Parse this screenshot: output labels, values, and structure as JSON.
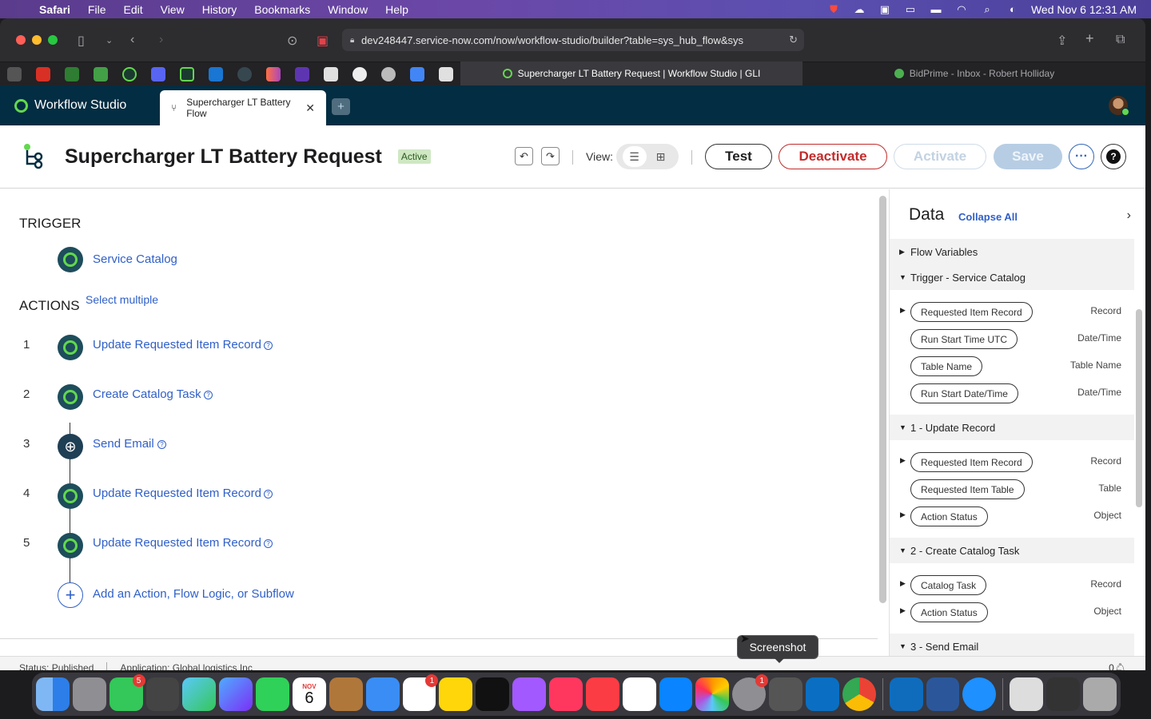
{
  "menubar": {
    "app_name": "Safari",
    "items": [
      "File",
      "Edit",
      "View",
      "History",
      "Bookmarks",
      "Window",
      "Help"
    ],
    "clock": "Wed Nov 6  12:31 AM"
  },
  "browser": {
    "url": "dev248447.service-now.com/now/workflow-studio/builder?table=sys_hub_flow&sys",
    "tabs": [
      {
        "label": "Supercharger LT Battery Request | Workflow Studio | GLI"
      },
      {
        "label": "BidPrime - Inbox - Robert Holliday"
      }
    ]
  },
  "app": {
    "brand": "Workflow Studio",
    "tab_label": "Supercharger LT Battery Flow",
    "add_tab": "+"
  },
  "header": {
    "title": "Supercharger LT Battery Request",
    "status_badge": "Active",
    "view_label": "View:",
    "test": "Test",
    "deactivate": "Deactivate",
    "activate": "Activate",
    "save": "Save",
    "more": "···",
    "help": "?"
  },
  "flow": {
    "trigger_heading": "TRIGGER",
    "trigger_name": "Service Catalog",
    "actions_heading": "ACTIONS",
    "select_multiple": "Select multiple",
    "steps": [
      {
        "num": "1",
        "label": "Update Requested Item Record"
      },
      {
        "num": "2",
        "label": "Create Catalog Task"
      },
      {
        "num": "3",
        "label": "Send Email"
      },
      {
        "num": "4",
        "label": "Update Requested Item Record"
      },
      {
        "num": "5",
        "label": "Update Requested Item Record"
      }
    ],
    "add_action": "Add an Action, Flow Logic, or Subflow"
  },
  "data_panel": {
    "title": "Data",
    "collapse_all": "Collapse All",
    "sections": {
      "flow_variables": "Flow Variables",
      "trigger": "Trigger - Service Catalog",
      "update_record": "1 - Update Record",
      "create_task": "2 - Create Catalog Task",
      "send_email": "3 - Send Email"
    },
    "trigger_rows": [
      {
        "name": "Requested Item Record",
        "type": "Record"
      },
      {
        "name": "Run Start Time UTC",
        "type": "Date/Time"
      },
      {
        "name": "Table Name",
        "type": "Table Name"
      },
      {
        "name": "Run Start Date/Time",
        "type": "Date/Time"
      }
    ],
    "update_rows": [
      {
        "name": "Requested Item Record",
        "type": "Record"
      },
      {
        "name": "Requested Item Table",
        "type": "Table"
      },
      {
        "name": "Action Status",
        "type": "Object"
      }
    ],
    "task_rows": [
      {
        "name": "Catalog Task",
        "type": "Record"
      },
      {
        "name": "Action Status",
        "type": "Object"
      }
    ]
  },
  "statusbar": {
    "status": "Status: Published",
    "application": "Application: Global logistics Inc",
    "notifications": "0"
  },
  "tooltip": "Screenshot",
  "dock": {
    "messages_badge": "5",
    "calendar_month": "NOV",
    "calendar_day": "6",
    "reminders_badge": "1",
    "settings_badge": "1"
  }
}
